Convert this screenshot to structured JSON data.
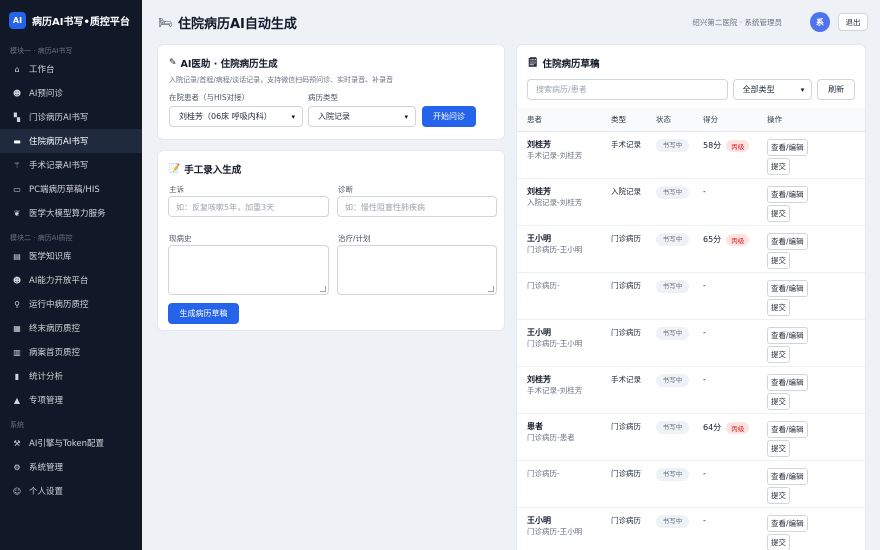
{
  "brand": {
    "logo": "AI",
    "name": "病历AI书写•质控平台"
  },
  "sidebar": {
    "section1": "模块一 · 病历AI书写",
    "section2": "模块二 · 病历AI质控",
    "section3": "系统",
    "items1": [
      {
        "label": "工作台",
        "icon": "home-icon",
        "glyph": "⌂"
      },
      {
        "label": "AI预问诊",
        "icon": "robot-icon",
        "glyph": "☻"
      },
      {
        "label": "门诊病历AI书写",
        "icon": "door-icon",
        "glyph": "▚"
      },
      {
        "label": "住院病历AI书写",
        "icon": "bed-icon",
        "glyph": "▬"
      },
      {
        "label": "手术记录AI书写",
        "icon": "scalpel-icon",
        "glyph": "⚚"
      },
      {
        "label": "PC端病历草稿/HIS",
        "icon": "monitor-icon",
        "glyph": "▭"
      },
      {
        "label": "医学大模型算力服务",
        "icon": "brain-icon",
        "glyph": "❦"
      }
    ],
    "items2": [
      {
        "label": "医学知识库",
        "icon": "book-icon",
        "glyph": "▤"
      },
      {
        "label": "AI能力开放平台",
        "icon": "robot-icon",
        "glyph": "☻"
      },
      {
        "label": "运行中病历质控",
        "icon": "magnifier-icon",
        "glyph": "⚲"
      },
      {
        "label": "终末病历质控",
        "icon": "clipboard-icon",
        "glyph": "▦"
      },
      {
        "label": "病案首页质控",
        "icon": "document-icon",
        "glyph": "▥"
      },
      {
        "label": "统计分析",
        "icon": "bar-chart-icon",
        "glyph": "▮"
      },
      {
        "label": "专项管理",
        "icon": "warning-icon",
        "glyph": "▲"
      }
    ],
    "items3": [
      {
        "label": "AI引擎与Token配置",
        "icon": "wrench-icon",
        "glyph": "⚒"
      },
      {
        "label": "系统管理",
        "icon": "gear-icon",
        "glyph": "⚙"
      },
      {
        "label": "个人设置",
        "icon": "user-icon",
        "glyph": "☺"
      }
    ]
  },
  "header": {
    "title": "住院病历AI自动生成",
    "user": "绍兴第二医院 · 系统管理员",
    "avatar": "系",
    "logout": "退出"
  },
  "ai_card": {
    "title": "AI医助 · 住院病历生成",
    "subtitle": "入院记录/首程/病程/谈话记录，支持微信扫码预问诊、实时录音、补录音",
    "patient_label": "在院患者（与HIS对接）",
    "patient_value": "刘桂芳（06床 呼吸内科）",
    "type_label": "病历类型",
    "type_value": "入院记录",
    "start_button": "开始问诊"
  },
  "manual_card": {
    "title": "手工录入生成",
    "chief_label": "主诉",
    "chief_placeholder": "如：反复咳嗽5年，加重3天",
    "diag_label": "诊断",
    "diag_placeholder": "如：慢性阻塞性肺疾病",
    "history_label": "现病史",
    "plan_label": "治疗/计划",
    "generate_button": "生成病历草稿"
  },
  "drafts": {
    "title": "住院病历草稿",
    "search_placeholder": "搜索病历/患者",
    "filter_value": "全部类型",
    "refresh": "刷新",
    "columns": [
      "患者",
      "类型",
      "状态",
      "得分",
      "操作"
    ],
    "view_label": "查看/编辑",
    "submit_label": "提交",
    "rows": [
      {
        "name": "刘桂芳",
        "sub": "手术记录-刘桂芳",
        "type": "手术记录",
        "status": "书写中",
        "score": "58分",
        "grade": "丙级"
      },
      {
        "name": "刘桂芳",
        "sub": "入院记录-刘桂芳",
        "type": "入院记录",
        "status": "书写中",
        "score": "-",
        "grade": ""
      },
      {
        "name": "王小明",
        "sub": "门诊病历-王小明",
        "type": "门诊病历",
        "status": "书写中",
        "score": "65分",
        "grade": "丙级"
      },
      {
        "name": "",
        "sub": "门诊病历-",
        "type": "门诊病历",
        "status": "书写中",
        "score": "-",
        "grade": ""
      },
      {
        "name": "王小明",
        "sub": "门诊病历-王小明",
        "type": "门诊病历",
        "status": "书写中",
        "score": "-",
        "grade": ""
      },
      {
        "name": "刘桂芳",
        "sub": "手术记录-刘桂芳",
        "type": "手术记录",
        "status": "书写中",
        "score": "-",
        "grade": ""
      },
      {
        "name": "患者",
        "sub": "门诊病历-患者",
        "type": "门诊病历",
        "status": "书写中",
        "score": "64分",
        "grade": "丙级"
      },
      {
        "name": "",
        "sub": "门诊病历-",
        "type": "门诊病历",
        "status": "书写中",
        "score": "-",
        "grade": ""
      },
      {
        "name": "王小明",
        "sub": "门诊病历-王小明",
        "type": "门诊病历",
        "status": "书写中",
        "score": "-",
        "grade": ""
      }
    ]
  }
}
